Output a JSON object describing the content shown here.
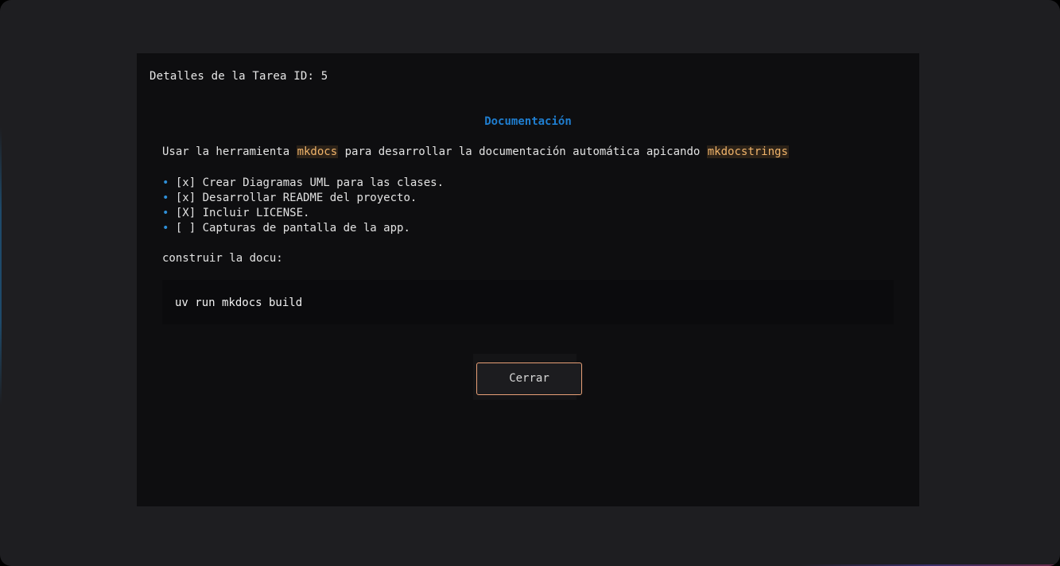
{
  "modal": {
    "title": "Detalles de la Tarea ID: 5",
    "heading": "Documentación",
    "description": {
      "part1": "Usar la herramienta ",
      "code1": "mkdocs",
      "part2": " para desarrollar la documentación automática apicando ",
      "code2": "mkdocstrings"
    },
    "bullet_glyph": "•",
    "tasks": [
      {
        "label": "[x] Crear Diagramas UML para las clases."
      },
      {
        "label": "[x] Desarrollar README del proyecto."
      },
      {
        "label": "[X] Incluir LICENSE."
      },
      {
        "label": "[ ] Capturas de pantalla de la app."
      }
    ],
    "build_label": "construir la docu:",
    "code_block": "uv run mkdocs build",
    "close_button": "Cerrar"
  },
  "colors": {
    "accent_blue": "#1f7ed0",
    "inline_code": "#f0b46a",
    "button_border": "#e8a077"
  }
}
